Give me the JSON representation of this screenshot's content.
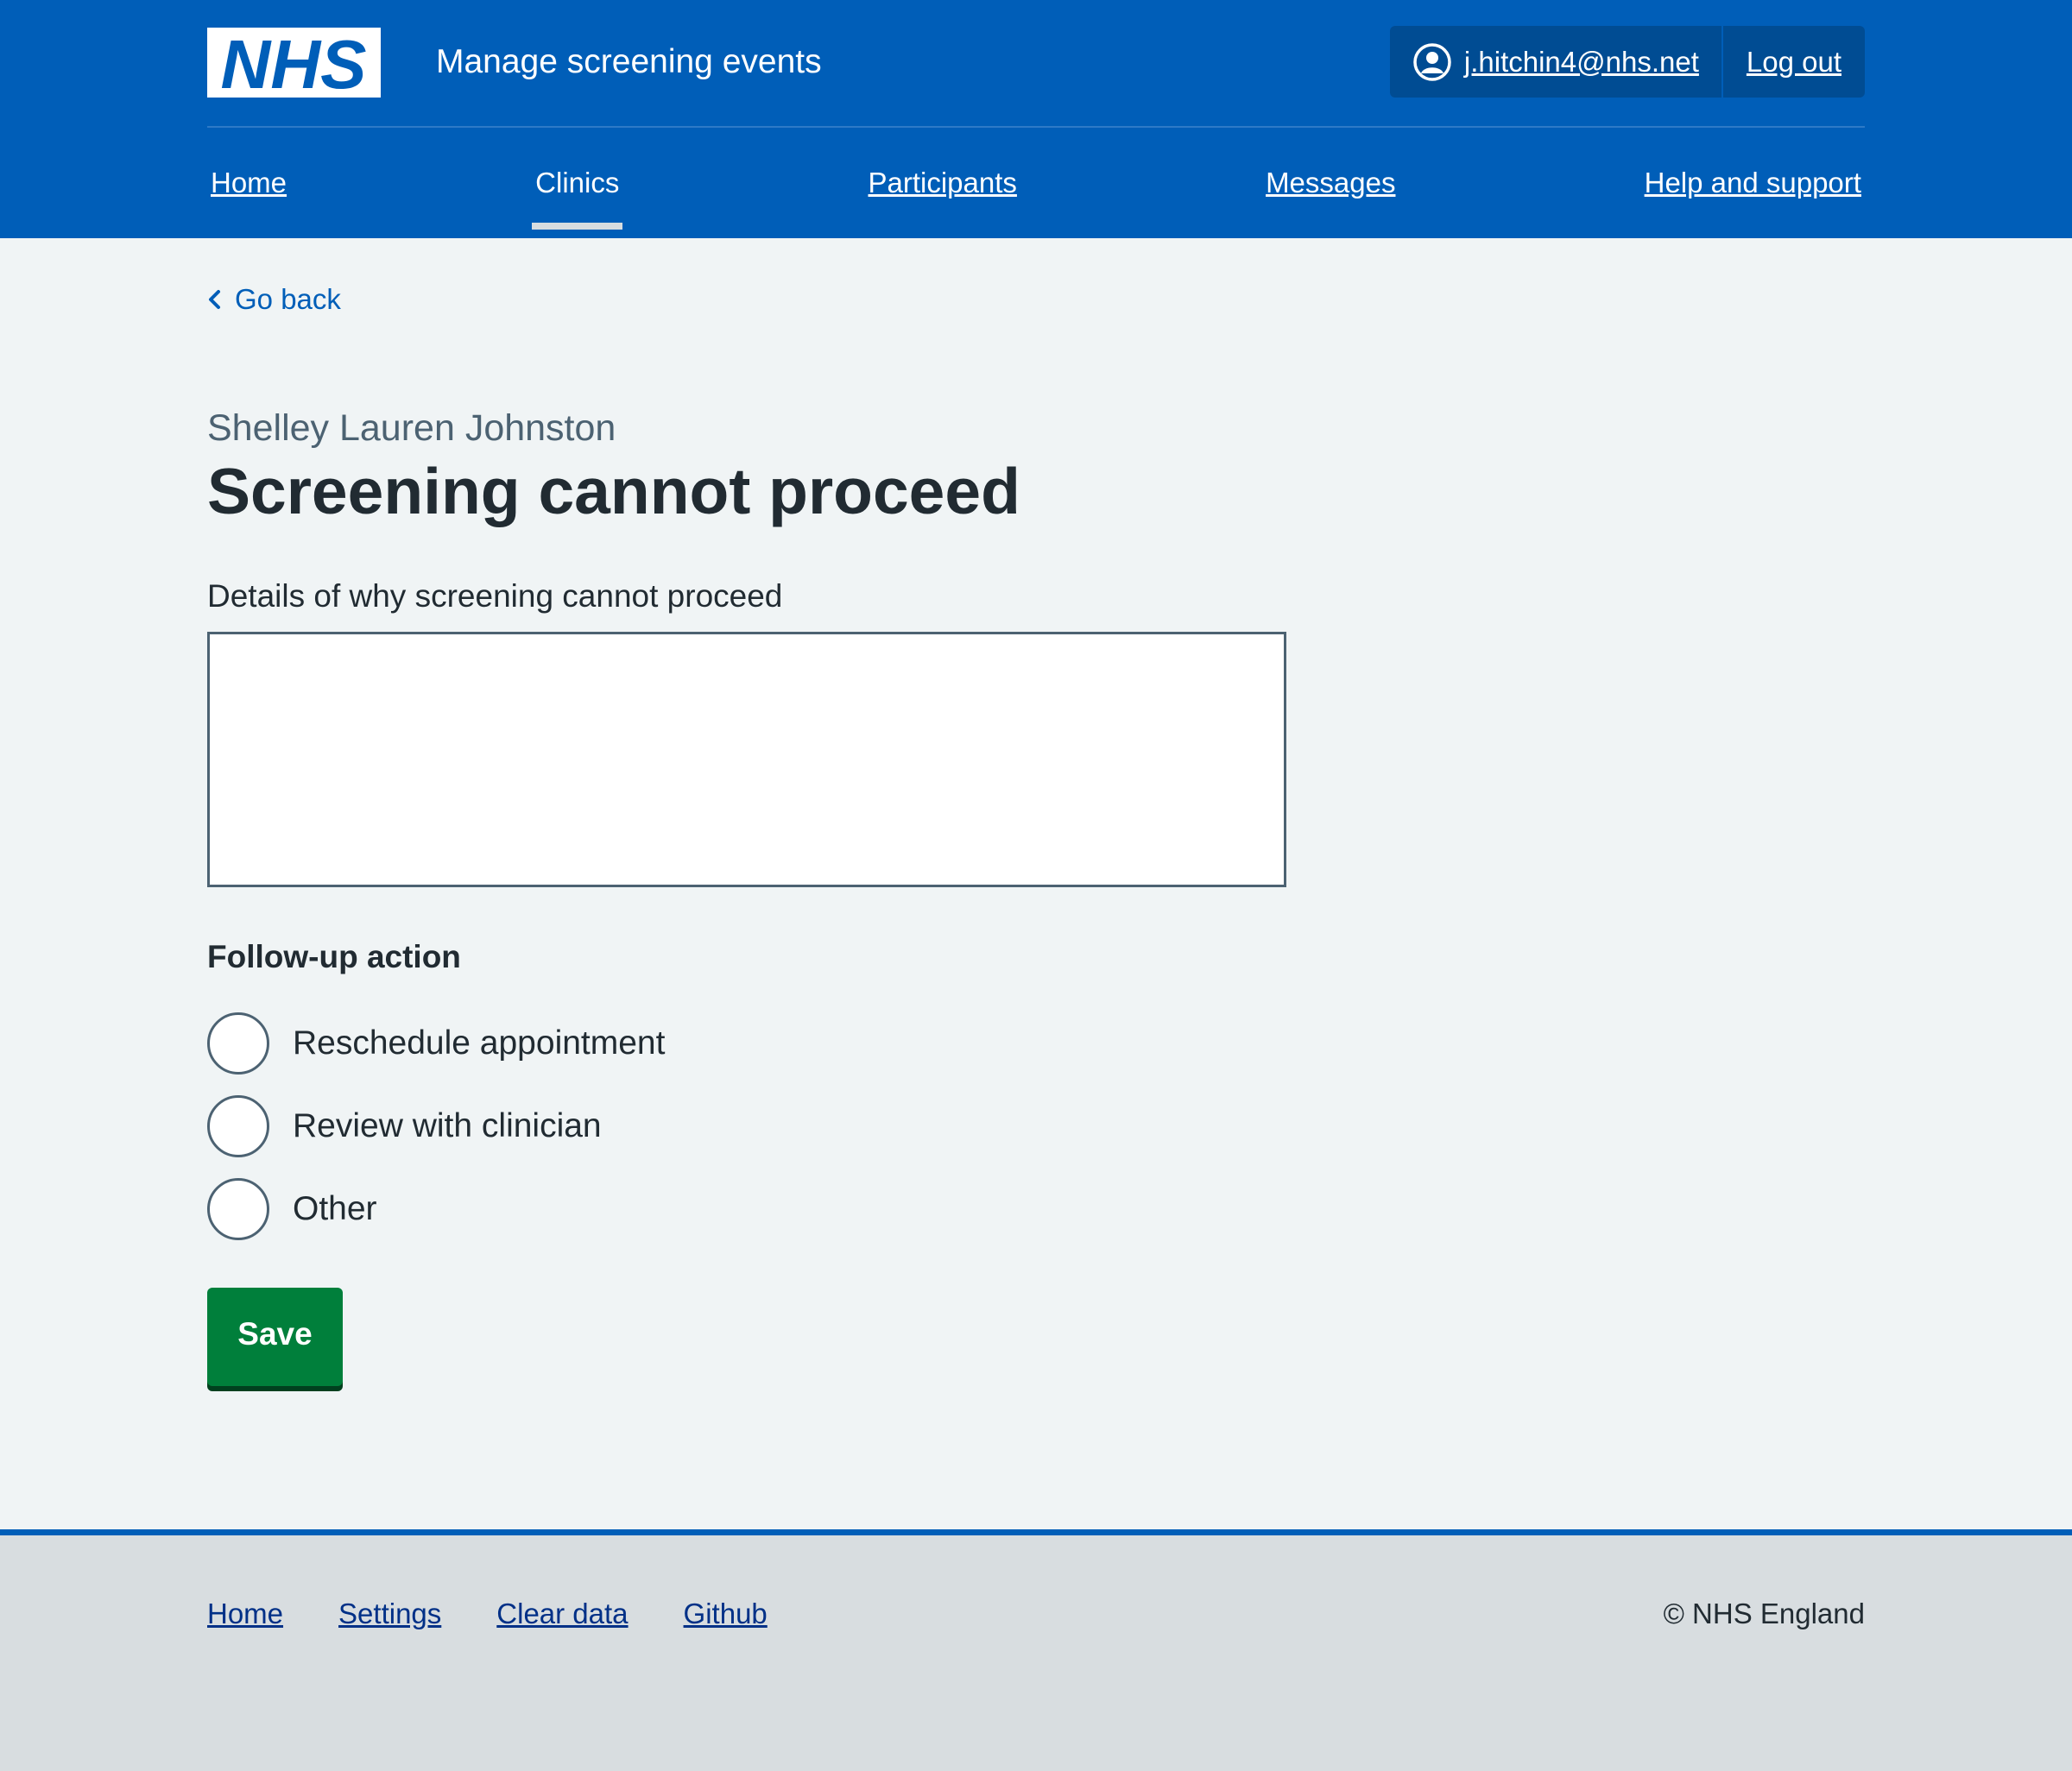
{
  "header": {
    "logo_text": "NHS",
    "service_name": "Manage screening events",
    "account": {
      "email": "j.hitchin4@nhs.net",
      "logout_label": "Log out"
    }
  },
  "nav": {
    "items": [
      {
        "label": "Home"
      },
      {
        "label": "Clinics",
        "current": true
      },
      {
        "label": "Participants"
      },
      {
        "label": "Messages"
      },
      {
        "label": "Help and support"
      }
    ]
  },
  "back_link": {
    "label": "Go back"
  },
  "page": {
    "caption": "Shelley Lauren Johnston",
    "title": "Screening cannot proceed"
  },
  "form": {
    "details_label": "Details of why screening cannot proceed",
    "details_value": "",
    "follow_up_legend": "Follow-up action",
    "options": [
      {
        "label": "Reschedule appointment",
        "selected": false
      },
      {
        "label": "Review with clinician",
        "selected": false
      },
      {
        "label": "Other",
        "selected": false
      }
    ],
    "save_label": "Save"
  },
  "footer": {
    "links": [
      {
        "label": "Home"
      },
      {
        "label": "Settings"
      },
      {
        "label": "Clear data"
      },
      {
        "label": "Github"
      }
    ],
    "copyright": "© NHS England"
  },
  "colors": {
    "brand_blue": "#005eb8",
    "dark_blue": "#004c93",
    "button_green": "#007f3b",
    "page_background": "#f0f4f5",
    "footer_background": "#d8dde0"
  }
}
